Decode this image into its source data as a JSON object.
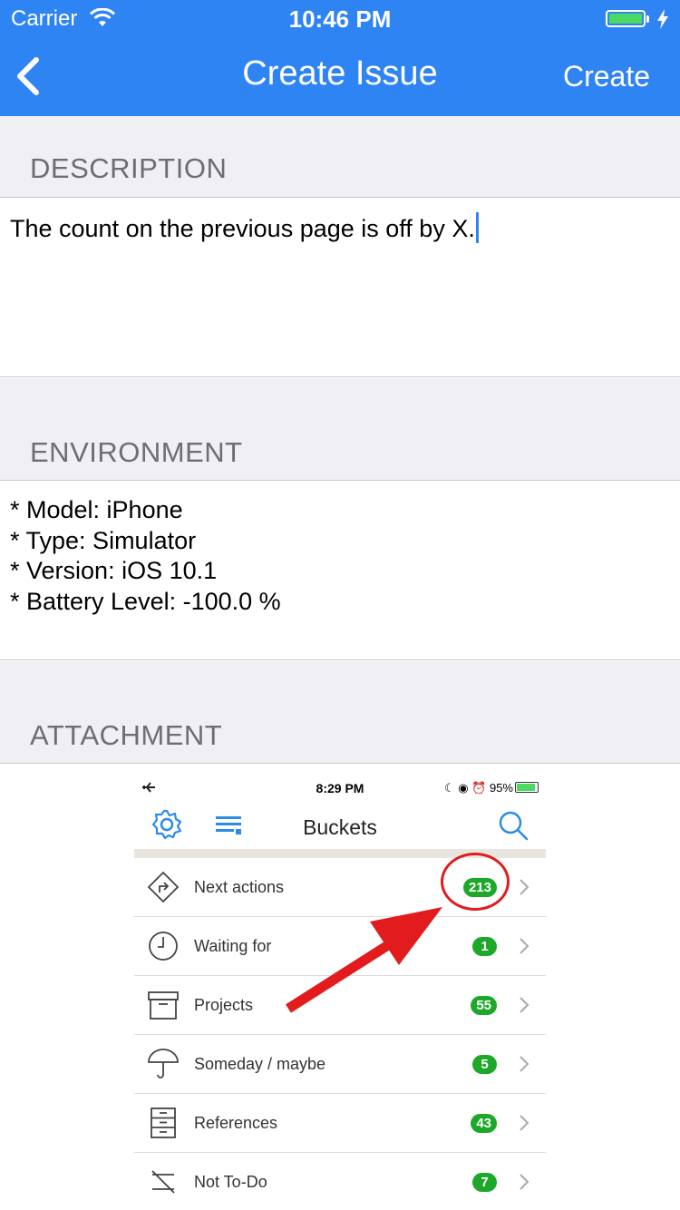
{
  "status_bar": {
    "carrier": "Carrier",
    "time": "10:46 PM"
  },
  "nav": {
    "title": "Create Issue",
    "action": "Create",
    "back_icon": "chevron-left-icon"
  },
  "sections": {
    "description": {
      "header": "DESCRIPTION",
      "text": "The count on the previous page is off by X."
    },
    "environment": {
      "header": "ENVIRONMENT",
      "lines": [
        "* Model: iPhone",
        "* Type: Simulator",
        "* Version: iOS 10.1",
        "* Battery Level: -100.0 %"
      ]
    },
    "attachment": {
      "header": "ATTACHMENT"
    }
  },
  "attachment_screenshot": {
    "status_time": "8:29 PM",
    "status_battery": "95%",
    "title": "Buckets",
    "rows": [
      {
        "label": "Next actions",
        "count": "213",
        "icon": "next-actions-icon"
      },
      {
        "label": "Waiting for",
        "count": "1",
        "icon": "clock-icon"
      },
      {
        "label": "Projects",
        "count": "55",
        "icon": "box-icon"
      },
      {
        "label": "Someday / maybe",
        "count": "5",
        "icon": "umbrella-icon"
      },
      {
        "label": "References",
        "count": "43",
        "icon": "cabinet-icon"
      },
      {
        "label": "Not To-Do",
        "count": "7",
        "icon": "not-todo-icon"
      }
    ],
    "annotation_color": "#e21c1c"
  },
  "colors": {
    "accent": "#2f84f4",
    "section_bg": "#efeff4",
    "badge_green": "#1ea82a"
  }
}
